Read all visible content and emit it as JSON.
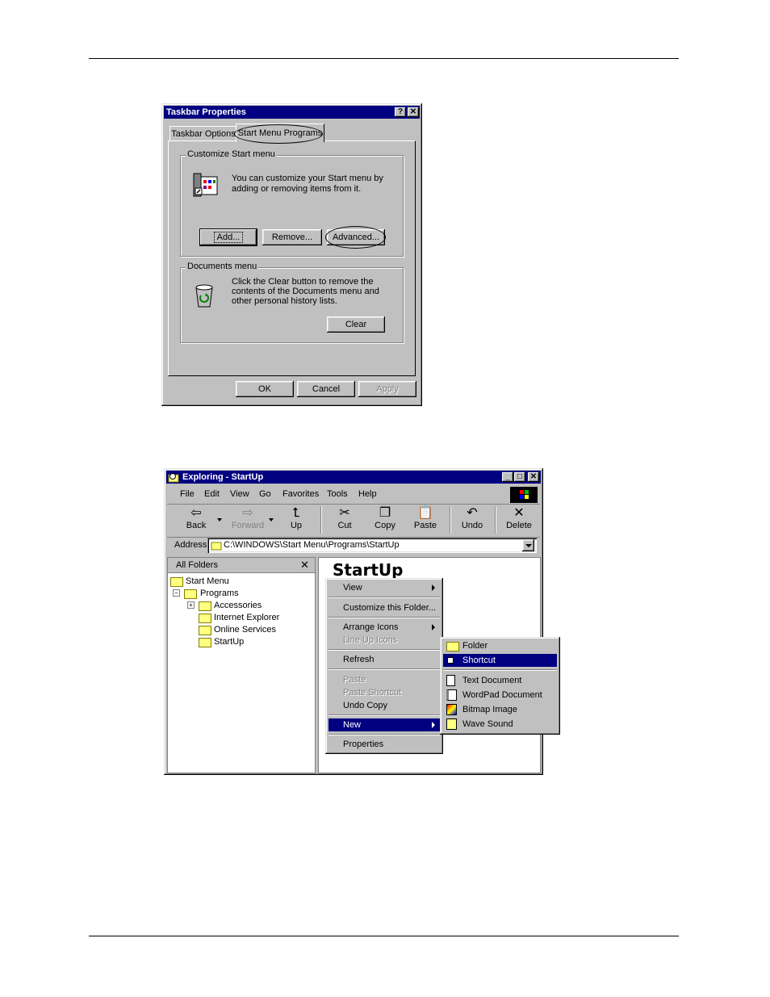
{
  "taskbar_dialog": {
    "title": "Taskbar Properties",
    "help_btn": "?",
    "close_btn": "✕",
    "tabs": [
      "Taskbar Options",
      "Start Menu Programs"
    ],
    "customize_group": {
      "label": "Customize Start menu",
      "text_line1": "You can customize your Start menu by",
      "text_line2": "adding or removing items from it.",
      "add_btn": "Add...",
      "remove_btn": "Remove...",
      "advanced_btn": "Advanced..."
    },
    "documents_group": {
      "label": "Documents menu",
      "text_line1": "Click the Clear button to remove the",
      "text_line2": "contents of the Documents menu and",
      "text_line3": "other personal history lists.",
      "clear_btn": "Clear"
    },
    "ok_btn": "OK",
    "cancel_btn": "Cancel",
    "apply_btn": "Apply"
  },
  "explorer": {
    "title": "Exploring - StartUp",
    "menu": [
      "File",
      "Edit",
      "View",
      "Go",
      "Favorites",
      "Tools",
      "Help"
    ],
    "toolbar": [
      "Back",
      "Forward",
      "Up",
      "Cut",
      "Copy",
      "Paste",
      "Undo",
      "Delete"
    ],
    "address_label": "Address",
    "address_value": "C:\\WINDOWS\\Start Menu\\Programs\\StartUp",
    "all_folders": "All Folders",
    "tree": [
      "Start Menu",
      "Programs",
      "Accessories",
      "Internet Explorer",
      "Online Services",
      "StartUp"
    ],
    "folder_heading": "StartUp",
    "context_menu": [
      "View",
      "Customize this Folder...",
      "Arrange Icons",
      "Line Up Icons",
      "Refresh",
      "Paste",
      "Paste Shortcut",
      "Undo Copy",
      "New",
      "Properties"
    ],
    "new_submenu": [
      "Folder",
      "Shortcut",
      "Text Document",
      "WordPad Document",
      "Bitmap Image",
      "Wave Sound"
    ]
  },
  "colors": {
    "title_bar": "#000080",
    "face": "#c0c0c0",
    "highlight": "#000080"
  }
}
